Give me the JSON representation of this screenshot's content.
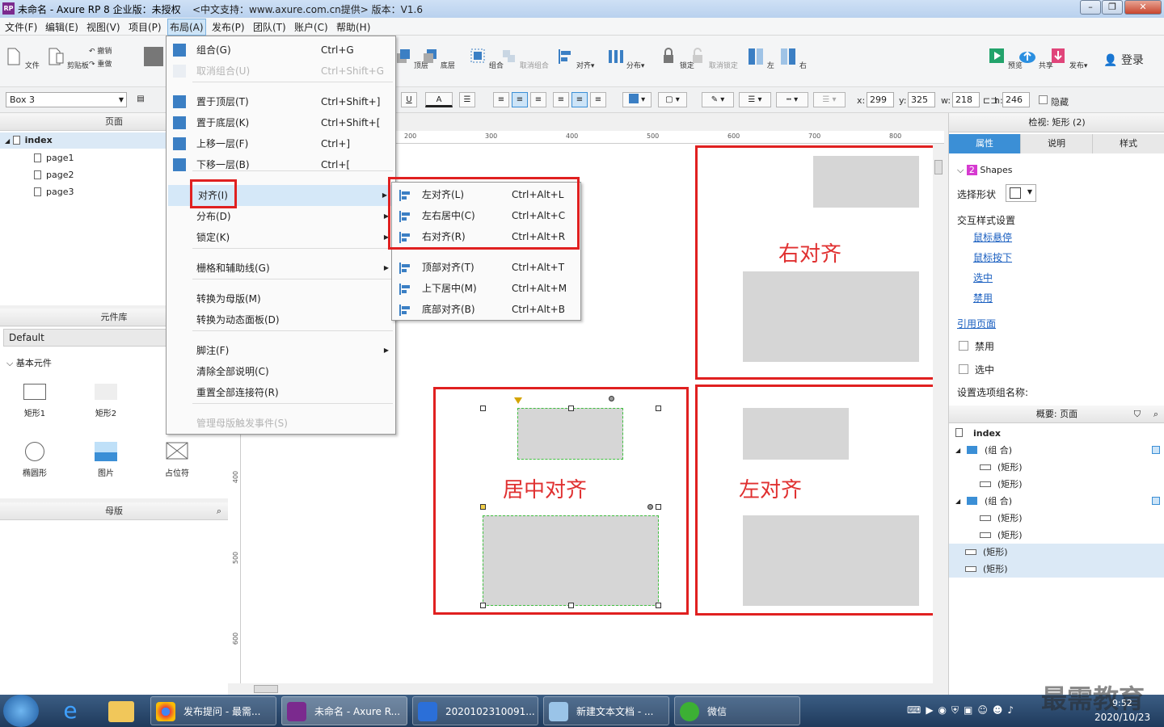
{
  "window": {
    "title": "未命名 - Axure RP 8 企业版：未授权",
    "subtitle": "<中文支持：www.axure.com.cn提供> 版本：V1.6",
    "app_icon": "RP"
  },
  "menubar": [
    "文件(F)",
    "编辑(E)",
    "视图(V)",
    "项目(P)",
    "布局(A)",
    "发布(P)",
    "团队(T)",
    "账户(C)",
    "帮助(H)"
  ],
  "toolbar": {
    "file_label": "文件",
    "clipboard_label": "剪贴板",
    "undo": "撤销",
    "redo": "重做",
    "top_label": "顶层",
    "bottom_label": "底层",
    "group_label": "组合",
    "ungroup_label": "取消组合",
    "align_label": "对齐▾",
    "distribute_label": "分布▾",
    "lock_label": "锁定",
    "unlock_label": "取消锁定",
    "left_label": "左",
    "right_label": "右",
    "preview_label": "预览",
    "share_label": "共享",
    "publish_label": "发布▾",
    "login_label": "登录"
  },
  "toolbar2": {
    "widget_name": "Box 3",
    "x_label": "x:",
    "x": "299",
    "y_label": "y:",
    "y": "325",
    "w_label": "w:",
    "w": "218",
    "h_label": "h:",
    "h": "246",
    "hide_label": "隐藏",
    "underline": "U",
    "fontcolor": "A"
  },
  "pages_panel": {
    "title": "页面",
    "root": "index",
    "children": [
      "page1",
      "page2",
      "page3"
    ]
  },
  "library_panel": {
    "title": "元件库",
    "selected": "Default",
    "section": "基本元件",
    "widgets": [
      "矩形1",
      "矩形2",
      "椭圆形",
      "图片",
      "占位符"
    ]
  },
  "masters_panel": {
    "title": "母版"
  },
  "ruler": {
    "top": [
      "200",
      "300",
      "400",
      "500",
      "600",
      "700",
      "800"
    ],
    "left": [
      "400",
      "500",
      "600"
    ]
  },
  "canvas": {
    "right_label": "右对齐",
    "center_label": "居中对齐",
    "left_label": "左对齐"
  },
  "inspector": {
    "title": "检视: 矩形 (2)",
    "tabs": [
      "属性",
      "说明",
      "样式"
    ],
    "shapes_count": "2",
    "shapes_label": "Shapes",
    "select_shape": "选择形状",
    "interaction_title": "交互样式设置",
    "links": [
      "鼠标悬停",
      "鼠标按下",
      "选中",
      "禁用"
    ],
    "ref_page": "引用页面",
    "disabled": "禁用",
    "selected": "选中",
    "option_group": "设置选项组名称:"
  },
  "outline": {
    "title": "概要: 页面",
    "rows": [
      {
        "indent": 0,
        "label": "index",
        "type": "page"
      },
      {
        "indent": 1,
        "label": "(组 合)",
        "type": "folder"
      },
      {
        "indent": 2,
        "label": "(矩形)",
        "type": "rect"
      },
      {
        "indent": 2,
        "label": "(矩形)",
        "type": "rect"
      },
      {
        "indent": 1,
        "label": "(组 合)",
        "type": "folder"
      },
      {
        "indent": 2,
        "label": "(矩形)",
        "type": "rect"
      },
      {
        "indent": 2,
        "label": "(矩形)",
        "type": "rect"
      },
      {
        "indent": 1,
        "label": "(矩形)",
        "type": "rect"
      },
      {
        "indent": 1,
        "label": "(矩形)",
        "type": "rect"
      }
    ]
  },
  "layout_menu": {
    "items": [
      {
        "label": "组合(G)",
        "shortcut": "Ctrl+G"
      },
      {
        "label": "取消组合(U)",
        "shortcut": "Ctrl+Shift+G",
        "disabled": true
      },
      {
        "label": "置于顶层(T)",
        "shortcut": "Ctrl+Shift+]"
      },
      {
        "label": "置于底层(K)",
        "shortcut": "Ctrl+Shift+["
      },
      {
        "label": "上移一层(F)",
        "shortcut": "Ctrl+]"
      },
      {
        "label": "下移一层(B)",
        "shortcut": "Ctrl+["
      },
      {
        "label": "对齐(I)",
        "shortcut": ""
      },
      {
        "label": "分布(D)",
        "shortcut": ""
      },
      {
        "label": "锁定(K)",
        "shortcut": ""
      },
      {
        "label": "栅格和辅助线(G)",
        "shortcut": ""
      },
      {
        "label": "转换为母版(M)",
        "shortcut": ""
      },
      {
        "label": "转换为动态面板(D)",
        "shortcut": ""
      },
      {
        "label": "脚注(F)",
        "shortcut": ""
      },
      {
        "label": "清除全部说明(C)",
        "shortcut": ""
      },
      {
        "label": "重置全部连接符(R)",
        "shortcut": ""
      },
      {
        "label": "管理母版触发事件(S)",
        "shortcut": "",
        "disabled": true
      }
    ]
  },
  "align_menu": {
    "items": [
      {
        "label": "左对齐(L)",
        "shortcut": "Ctrl+Alt+L"
      },
      {
        "label": "左右居中(C)",
        "shortcut": "Ctrl+Alt+C"
      },
      {
        "label": "右对齐(R)",
        "shortcut": "Ctrl+Alt+R"
      },
      {
        "label": "顶部对齐(T)",
        "shortcut": "Ctrl+Alt+T"
      },
      {
        "label": "上下居中(M)",
        "shortcut": "Ctrl+Alt+M"
      },
      {
        "label": "底部对齐(B)",
        "shortcut": "Ctrl+Alt+B"
      }
    ]
  },
  "taskbar": {
    "items": [
      "发布提问 - 最需...",
      "未命名 - Axure R...",
      "2020102310091...",
      "新建文本文档 - ...",
      "微信"
    ],
    "time": "9:52",
    "date": "2020/10/23",
    "watermark": "最需教育"
  },
  "colors": {
    "accent": "#3b8fd6",
    "red": "#e02020",
    "shape": "#d6d6d6"
  }
}
